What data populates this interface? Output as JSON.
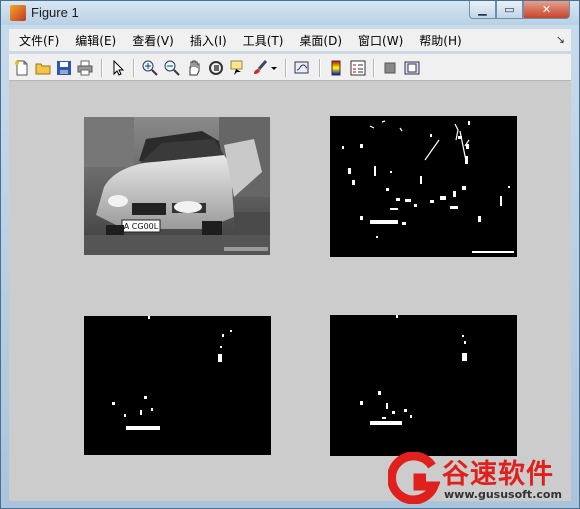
{
  "window": {
    "title": "Figure 1",
    "controls": {
      "minimize": "▁",
      "maximize": "▭",
      "close": "✕"
    }
  },
  "menu": {
    "items": [
      "文件(F)",
      "编辑(E)",
      "查看(V)",
      "插入(I)",
      "工具(T)",
      "桌面(D)",
      "窗口(W)",
      "帮助(H)"
    ],
    "dock_glyph": "↘"
  },
  "toolbar": {
    "icons": [
      "new-figure-icon",
      "open-file-icon",
      "save-icon",
      "print-icon",
      "edit-plot-arrow-icon",
      "zoom-in-icon",
      "zoom-out-icon",
      "pan-hand-icon",
      "rotate-3d-icon",
      "data-cursor-icon",
      "brush-icon",
      "brush-dropdown-icon",
      "link-plot-icon",
      "colorbar-icon",
      "legend-icon",
      "hide-plot-tools-icon",
      "show-plot-tools-icon"
    ]
  },
  "figure": {
    "background": "#cccccc",
    "subplots": [
      {
        "name": "grayscale-car-image",
        "type": "grayscale",
        "plate_text": "A CG00L"
      },
      {
        "name": "binary-edge-image-1",
        "type": "binary"
      },
      {
        "name": "binary-edge-image-2",
        "type": "binary"
      },
      {
        "name": "binary-edge-image-3",
        "type": "binary"
      }
    ]
  },
  "watermark": {
    "title": "谷速软件",
    "url": "www.gususoft.com",
    "color": "#e0201c"
  }
}
